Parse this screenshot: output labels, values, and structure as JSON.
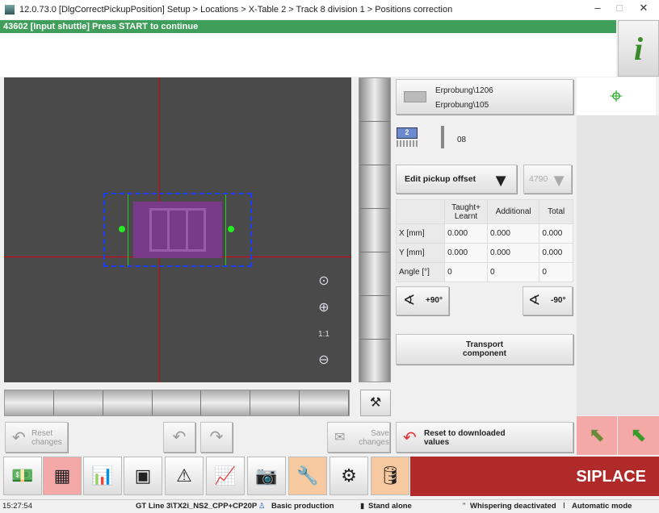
{
  "title": "12.0.73.0 [DlgCorrectPickupPosition] Setup > Locations > X-Table 2 > Track 8 division 1 > Positions correction",
  "window_controls": {
    "minimize": "–",
    "maximize": "□",
    "close": "✕"
  },
  "banner": "43602 [Input shuttle] Press START to continue",
  "info_button": "i",
  "component": {
    "line1": "Erprobung\\1206",
    "line2": "Erprobung\\105"
  },
  "nozzle": {
    "badge": "2",
    "value": "08"
  },
  "mode_dropdown": "Edit pickup offset",
  "id_dropdown": "4790",
  "offset_table": {
    "headers": [
      "",
      "Taught+\nLearnt",
      "Additional",
      "Total"
    ],
    "rows": [
      [
        "X [mm]",
        "0.000",
        "0.000",
        "0.000"
      ],
      [
        "Y [mm]",
        "0.000",
        "0.000",
        "0.000"
      ],
      [
        "Angle [°]",
        "0",
        "0",
        "0"
      ]
    ]
  },
  "rotate_plus": "+90°",
  "rotate_minus": "-90°",
  "transport": "Transport component",
  "buttons": {
    "reset_changes": "Reset changes",
    "save_changes": "Save changes",
    "reset_downloaded": "Reset to downloaded values"
  },
  "brand": "SIPLACE",
  "status": {
    "time": "15:27:54",
    "line": "GT Line 3\\TX2i_NS2_CPP+CP20P",
    "production": "Basic production",
    "standalone": "Stand alone",
    "whispering": "Whispering deactivated",
    "mode": "Automatic mode"
  },
  "colors": {
    "banner": "#3e9e5a",
    "brand": "#b02a2a",
    "crosshair": "#dd0000",
    "selection": "#1a3cff",
    "component": "#8a3a9a"
  }
}
